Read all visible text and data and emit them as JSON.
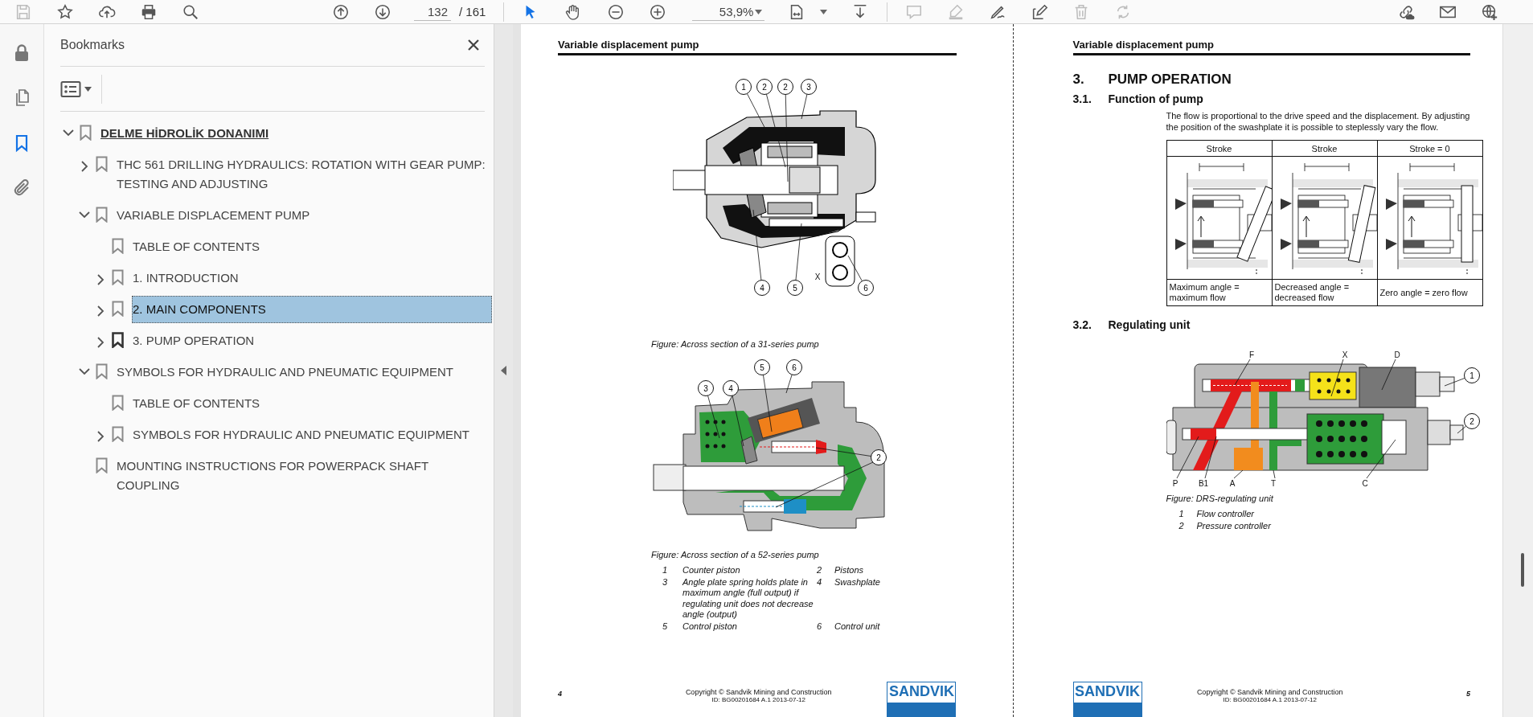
{
  "toolbar": {
    "file_tools": [
      {
        "kind": "save",
        "disabled": true
      },
      {
        "kind": "star",
        "disabled": false
      },
      {
        "kind": "upload",
        "disabled": false
      },
      {
        "kind": "print",
        "disabled": false
      },
      {
        "kind": "search",
        "disabled": false
      }
    ],
    "nav_tools": [
      {
        "kind": "up",
        "disabled": false
      },
      {
        "kind": "down",
        "disabled": false
      }
    ],
    "page_field": {
      "value": "132"
    },
    "page_total": "/ 161",
    "pointer_tools": [
      {
        "kind": "select",
        "selected": true
      },
      {
        "kind": "hand",
        "selected": false
      }
    ],
    "zoom_tools": [
      {
        "kind": "zoomout",
        "disabled": false
      },
      {
        "kind": "zoomin",
        "disabled": false
      }
    ],
    "zoom_field": {
      "value": "53,9%"
    },
    "view_tools": [
      {
        "kind": "fit",
        "disabled": false
      },
      {
        "kind": "scroll",
        "disabled": false
      }
    ],
    "edit_tools": [
      {
        "kind": "comment",
        "disabled": true
      },
      {
        "kind": "highlight",
        "disabled": true
      },
      {
        "kind": "sign",
        "disabled": false
      },
      {
        "kind": "edit",
        "disabled": false
      },
      {
        "kind": "delete",
        "disabled": true
      },
      {
        "kind": "rotate",
        "disabled": true
      }
    ],
    "share_tools": [
      {
        "kind": "share",
        "disabled": false
      },
      {
        "kind": "mail",
        "disabled": false
      },
      {
        "kind": "globe",
        "disabled": false
      }
    ]
  },
  "rail": [
    {
      "kind": "lock",
      "selected": false
    },
    {
      "kind": "pages",
      "selected": false
    },
    {
      "kind": "bookmarks",
      "selected": true
    },
    {
      "kind": "attachments",
      "selected": false
    }
  ],
  "bookmarks_panel": {
    "title": "Bookmarks",
    "items": [
      {
        "label": "DELME HİDROLİK DONANIMI",
        "kind": "root",
        "expanded": true,
        "selected": false,
        "current": false,
        "children": [
          {
            "label": "THC 561 DRILLING HYDRAULICS: ROTATION WITH GEAR PUMP: TESTING AND ADJUSTING",
            "kind": "branch",
            "expanded": false,
            "selected": false,
            "current": false
          },
          {
            "label": "VARIABLE DISPLACEMENT PUMP",
            "kind": "branch",
            "expanded": true,
            "selected": false,
            "current": false,
            "children": [
              {
                "label": "TABLE OF CONTENTS",
                "kind": "leaf",
                "selected": false,
                "current": false
              },
              {
                "label": "1. INTRODUCTION",
                "kind": "branch",
                "expanded": false,
                "selected": false,
                "current": false
              },
              {
                "label": "2. MAIN COMPONENTS",
                "kind": "branch",
                "expanded": false,
                "selected": true,
                "current": false
              },
              {
                "label": "3. PUMP OPERATION",
                "kind": "branch",
                "expanded": false,
                "selected": false,
                "current": true
              }
            ]
          },
          {
            "label": "SYMBOLS FOR HYDRAULIC AND PNEUMATIC EQUIPMENT",
            "kind": "branch",
            "expanded": true,
            "selected": false,
            "current": false,
            "children": [
              {
                "label": "TABLE OF CONTENTS",
                "kind": "leaf",
                "selected": false,
                "current": false
              },
              {
                "label": "SYMBOLS FOR HYDRAULIC AND PNEUMATIC EQUIPMENT",
                "kind": "branch",
                "expanded": false,
                "selected": false,
                "current": false
              }
            ]
          },
          {
            "label": "MOUNTING INSTRUCTIONS FOR POWERPACK SHAFT COUPLING",
            "kind": "leaf",
            "selected": false,
            "current": false
          }
        ]
      }
    ]
  },
  "left_page": {
    "header": "Variable displacement pump",
    "figure_1": {
      "callouts": [
        "1",
        "2",
        "2",
        "3",
        "4",
        "5",
        "6"
      ],
      "port_label": "X",
      "caption": "Figure: Across section of a 31-series pump"
    },
    "figure_2": {
      "callouts": [
        "5",
        "6",
        "3",
        "4",
        "2"
      ],
      "caption": "Figure: Across section of a 52-series pump"
    },
    "legend": [
      {
        "number": "1",
        "text": "Counter piston"
      },
      {
        "number": "2",
        "text": "Pistons"
      },
      {
        "number": "3",
        "text": "Angle plate spring holds plate in maximum angle (full output) if regulating unit does not decrease angle (output)"
      },
      {
        "number": "4",
        "text": "Swashplate"
      },
      {
        "number": "5",
        "text": "Control piston"
      },
      {
        "number": "6",
        "text": "Control unit"
      }
    ],
    "footer": {
      "page_number": "4",
      "copyright": "Copyright © Sandvik Mining and Construction",
      "doc_id": "ID: BG00201684 A.1 2013-07-12",
      "logo": "SANDVIK"
    }
  },
  "right_page": {
    "header": "Variable displacement pump",
    "section": {
      "number": "3.",
      "title": "PUMP OPERATION"
    },
    "subsection_1": {
      "number": "3.1.",
      "title": "Function of pump"
    },
    "paragraph": "The flow is proportional to the drive speed and the displacement. By adjusting the position of the swashplate it is possible to steplessly vary the flow.",
    "table": {
      "columns": [
        "Stroke",
        "Stroke",
        "Stroke = 0"
      ],
      "captions": [
        "Maximum angle = maximum flow",
        "Decreased angle = decreased flow",
        "Zero angle = zero flow"
      ]
    },
    "subsection_2": {
      "number": "3.2.",
      "title": "Regulating unit"
    },
    "figure": {
      "top_labels": [
        "F",
        "X",
        "D"
      ],
      "bottom_labels": [
        "P",
        "B1",
        "A",
        "T",
        "C"
      ],
      "callouts": [
        "1",
        "2"
      ],
      "caption": "Figure: DRS-regulating unit"
    },
    "legend": [
      {
        "number": "1",
        "text": "Flow controller"
      },
      {
        "number": "2",
        "text": "Pressure controller"
      }
    ],
    "footer": {
      "logo": "SANDVIK",
      "copyright": "Copyright © Sandvik Mining and Construction",
      "doc_id": "ID: BG00201684 A.1 2013-07-12",
      "page_number": "5"
    }
  }
}
